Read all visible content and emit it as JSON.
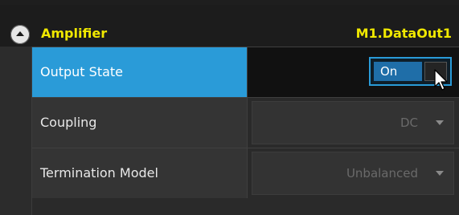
{
  "section": {
    "title": "Amplifier",
    "identifier": "M1.DataOut1",
    "collapse_icon": "chevron-up-icon",
    "title_color": "#f0e800"
  },
  "rows": [
    {
      "label": "Output State",
      "control": "toggle",
      "value": "On",
      "selected": true
    },
    {
      "label": "Coupling",
      "control": "dropdown",
      "value": "DC",
      "disabled": true
    },
    {
      "label": "Termination Model",
      "control": "dropdown",
      "value": "Unbalanced",
      "disabled": true
    }
  ],
  "colors": {
    "selected_row": "#2a9bd8",
    "toggle_on": "#1f6ea8"
  }
}
